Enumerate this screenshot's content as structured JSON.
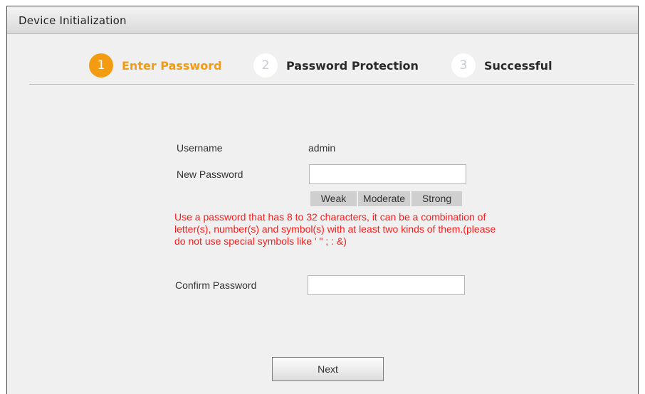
{
  "window": {
    "title": "Device Initialization"
  },
  "steps": [
    {
      "number": "1",
      "label": "Enter Password",
      "state": "active"
    },
    {
      "number": "2",
      "label": "Password Protection",
      "state": "pending"
    },
    {
      "number": "3",
      "label": "Successful",
      "state": "pending"
    }
  ],
  "form": {
    "username_label": "Username",
    "username_value": "admin",
    "new_password_label": "New Password",
    "new_password_value": "",
    "strength": {
      "weak": "Weak",
      "moderate": "Moderate",
      "strong": "Strong"
    },
    "hint": "Use a password that has 8 to 32 characters, it can be a combination of letter(s), number(s) and symbol(s) with at least two kinds of them.(please do not use special symbols like ' \" ; : &)",
    "confirm_password_label": "Confirm Password",
    "confirm_password_value": ""
  },
  "actions": {
    "next_label": "Next"
  },
  "colors": {
    "accent": "#f39c12",
    "hint_text": "#ff1a1a",
    "inactive_step_number": "#c4cbd4",
    "panel_background": "#f0f0f0"
  }
}
